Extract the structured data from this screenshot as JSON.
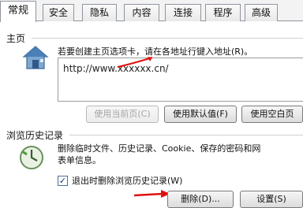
{
  "tabs": [
    {
      "label": "常规",
      "active": true
    },
    {
      "label": "安全",
      "active": false
    },
    {
      "label": "隐私",
      "active": false
    },
    {
      "label": "内容",
      "active": false
    },
    {
      "label": "连接",
      "active": false
    },
    {
      "label": "程序",
      "active": false
    },
    {
      "label": "高级",
      "active": false
    }
  ],
  "homepage": {
    "section_label": "主页",
    "description": "若要创建主页选项卡，请在各地址行键入地址(R)。",
    "url": "http://www.xxxxxx.cn/",
    "icon": "house-icon",
    "buttons": {
      "use_current": "使用当前页(C)",
      "use_default": "使用默认值(F)",
      "use_blank": "使用空白页"
    }
  },
  "history": {
    "section_label": "浏览历史记录",
    "description_line1": "删除临时文件、历史记录、Cookie、保存的密码和网",
    "description_line2": "表单信息。",
    "icon": "history-clock-icon",
    "checkbox_label": "退出时删除浏览历史记录(W)",
    "checkbox_checked": true,
    "buttons": {
      "delete": "删除(D)...",
      "settings": "设置(S)"
    }
  },
  "annotation_color": "#e01010"
}
